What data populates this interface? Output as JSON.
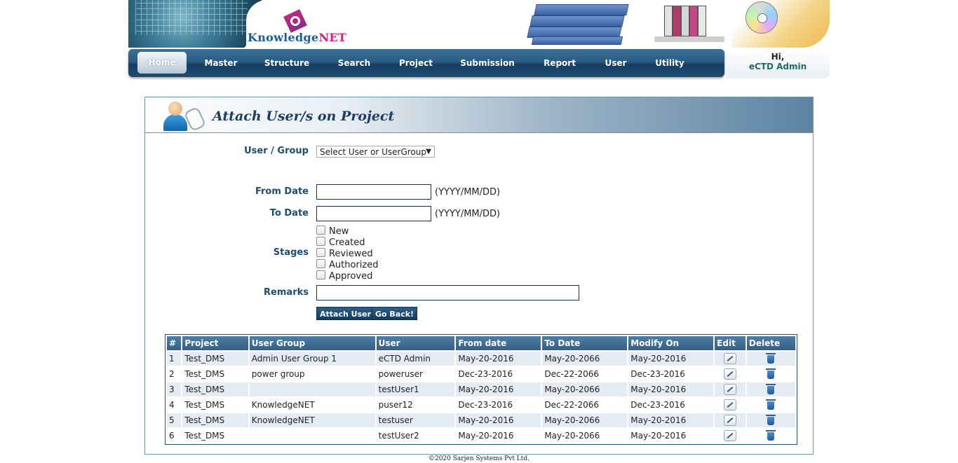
{
  "brand": {
    "name_part1": "Knowledge",
    "name_part2": "NET"
  },
  "nav": {
    "items": [
      {
        "label": "Home",
        "active": true
      },
      {
        "label": "Master"
      },
      {
        "label": "Structure"
      },
      {
        "label": "Search"
      },
      {
        "label": "Project"
      },
      {
        "label": "Submission"
      },
      {
        "label": "Report"
      },
      {
        "label": "User"
      },
      {
        "label": "Utility"
      }
    ]
  },
  "greeting": {
    "hi": "Hi,",
    "user": "eCTD Admin"
  },
  "panel": {
    "title": "Attach User/s on Project"
  },
  "form": {
    "user_group_label": "User / Group",
    "user_group_value": "Select User or UserGroup",
    "from_date_label": "From Date",
    "from_date_value": "",
    "to_date_label": "To Date",
    "to_date_value": "",
    "date_hint": "(YYYY/MM/DD)",
    "stages_label": "Stages",
    "stages": [
      {
        "label": "New",
        "checked": false
      },
      {
        "label": "Created",
        "checked": false
      },
      {
        "label": "Reviewed",
        "checked": false
      },
      {
        "label": "Authorized",
        "checked": false
      },
      {
        "label": "Approved",
        "checked": false
      }
    ],
    "remarks_label": "Remarks",
    "remarks_value": "",
    "attach_button": "Attach User",
    "back_button": "Go Back!"
  },
  "table": {
    "headers": [
      "#",
      "Project",
      "User Group",
      "User",
      "From date",
      "To Date",
      "Modify On",
      "Edit",
      "Delete"
    ],
    "rows": [
      [
        "1",
        "Test_DMS",
        "Admin User Group 1",
        "eCTD Admin",
        "May-20-2016",
        "May-20-2066",
        "May-20-2016"
      ],
      [
        "2",
        "Test_DMS",
        "power group",
        "poweruser",
        "Dec-23-2016",
        "Dec-22-2066",
        "Dec-23-2016"
      ],
      [
        "3",
        "Test_DMS",
        "",
        "testUser1",
        "May-20-2016",
        "May-20-2066",
        "May-20-2016"
      ],
      [
        "4",
        "Test_DMS",
        "KnowledgeNET",
        "puser12",
        "Dec-23-2016",
        "Dec-22-2066",
        "Dec-23-2016"
      ],
      [
        "5",
        "Test_DMS",
        "KnowledgeNET",
        "testuser",
        "May-20-2016",
        "May-20-2066",
        "May-20-2016"
      ],
      [
        "6",
        "Test_DMS",
        "",
        "testUser2",
        "May-20-2016",
        "May-20-2066",
        "May-20-2016"
      ]
    ]
  },
  "footer": {
    "text": "©2020 Sarjen Systems Pvt Ltd."
  },
  "colors": {
    "nav_dark": "#153f61",
    "accent": "#1e4d6f",
    "brand_pink": "#d4237a",
    "brand_blue": "#1d5b9a"
  }
}
